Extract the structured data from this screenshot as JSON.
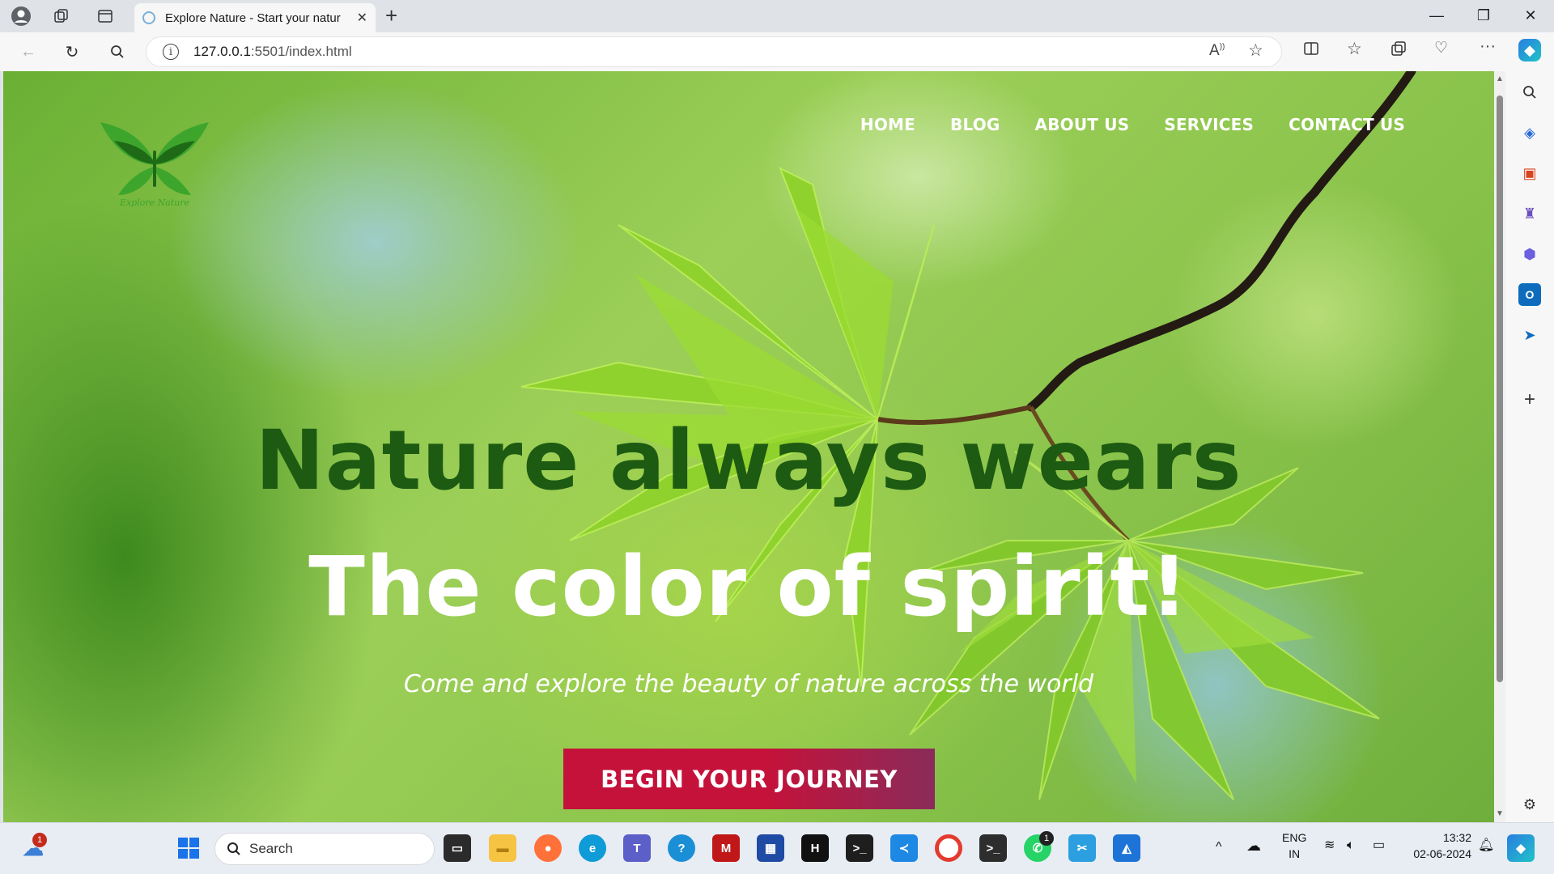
{
  "browser": {
    "tab_title": "Explore Nature - Start your natur",
    "url_host": "127.0.0.1",
    "url_rest": ":5501/index.html",
    "new_tab": "+",
    "tab_close": "✕"
  },
  "site": {
    "logo_text": "Explore Nature",
    "menu": [
      "HOME",
      "BLOG",
      "ABOUT US",
      "SERVICES",
      "CONTACT US"
    ],
    "headline_primary": "Nature always wears",
    "headline_secondary": "The color of spirit!",
    "subheading": "Come and explore the beauty of nature across the world",
    "cta_label": "BEGIN YOUR JOURNEY",
    "colors": {
      "headline_primary": "#1d5a12",
      "cta": "#c4123a"
    }
  },
  "taskbar": {
    "search_placeholder": "Search",
    "weather_badge": "1",
    "whatsapp_badge": "1",
    "language_top": "ENG",
    "language_bottom": "IN",
    "time": "13:32",
    "date": "02-06-2024"
  }
}
